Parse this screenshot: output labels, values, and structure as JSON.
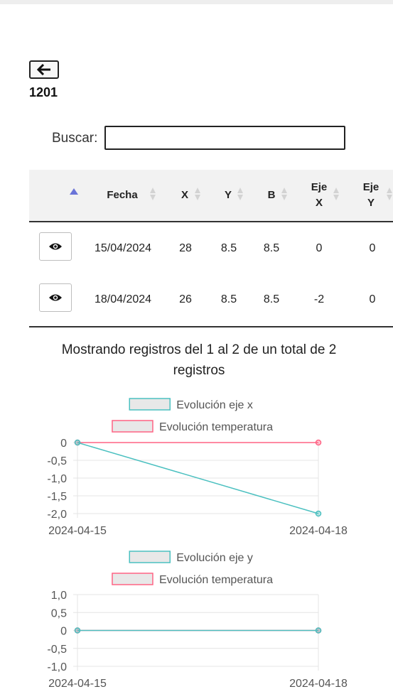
{
  "record": {
    "id": "1201"
  },
  "search": {
    "label": "Buscar:",
    "value": ""
  },
  "table": {
    "columns": [
      "Fecha",
      "X",
      "Y",
      "B",
      "Eje X",
      "Eje Y"
    ],
    "rows": [
      [
        "15/04/2024",
        "28",
        "8.5",
        "8.5",
        "0",
        "0"
      ],
      [
        "18/04/2024",
        "26",
        "8.5",
        "8.5",
        "-2",
        "0"
      ]
    ]
  },
  "info": "Mostrando registros del 1 al 2 de un total de 2 registros",
  "colors": {
    "teal": "#4bc0c0",
    "red": "#ff6384",
    "sort_active": "#6a74d8"
  },
  "icons": {
    "back": "arrow-left-icon",
    "view": "eye-icon"
  },
  "chart_data": [
    {
      "type": "line",
      "x": [
        "2024-04-15",
        "2024-04-18"
      ],
      "series": [
        {
          "name": "Evolución eje x",
          "values": [
            0,
            -2
          ],
          "color": "#4bc0c0"
        },
        {
          "name": "Evolución temperatura",
          "values": [
            0,
            0
          ],
          "color": "#ff6384"
        }
      ],
      "ylim": [
        -2,
        0
      ],
      "yticks": [
        "0",
        "-0,5",
        "-1,0",
        "-1,5",
        "-2,0"
      ],
      "legend": "top",
      "grid": true
    },
    {
      "type": "line",
      "x": [
        "2024-04-15",
        "2024-04-18"
      ],
      "series": [
        {
          "name": "Evolución eje y",
          "values": [
            0,
            0
          ],
          "color": "#4bc0c0"
        },
        {
          "name": "Evolución temperatura",
          "values": [
            0,
            0
          ],
          "color": "#ff6384"
        }
      ],
      "ylim": [
        -1,
        1
      ],
      "yticks": [
        "1,0",
        "0,5",
        "0",
        "-0,5",
        "-1,0"
      ],
      "legend": "top",
      "grid": true
    }
  ]
}
